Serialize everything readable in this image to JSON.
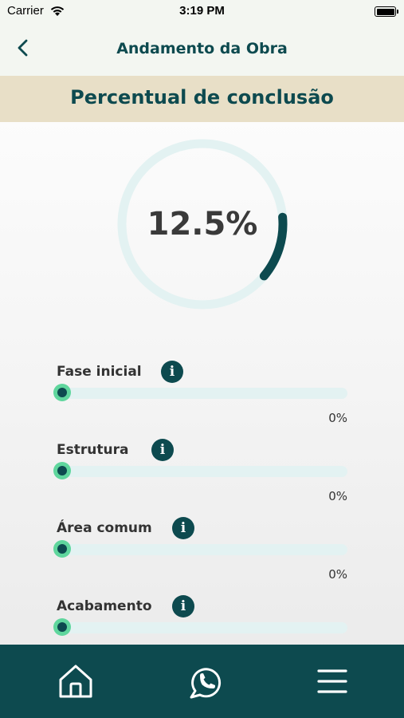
{
  "status_bar": {
    "carrier": "Carrier",
    "time": "3:19 PM",
    "icons": [
      "wifi-icon",
      "battery-icon"
    ]
  },
  "nav": {
    "title": "Andamento da Obra",
    "back_icon": "chevron-left-icon"
  },
  "section": {
    "heading": "Percentual de conclusão"
  },
  "progress": {
    "label": "12.5%",
    "fraction": 0.125
  },
  "phases": [
    {
      "label": "Fase inicial",
      "value": "0%",
      "fraction": 0
    },
    {
      "label": "Estrutura",
      "value": "0%",
      "fraction": 0
    },
    {
      "label": "Área comum",
      "value": "0%",
      "fraction": 0
    },
    {
      "label": "Acabamento",
      "value": "",
      "fraction": 0
    }
  ],
  "tab_bar": {
    "items": [
      "home-icon",
      "whatsapp-icon",
      "menu-icon"
    ]
  },
  "colors": {
    "primary": "#0d4a4f",
    "accent": "#5fd69d",
    "track": "#e3f2f2",
    "header_band": "#e8dfc7",
    "nav_bg": "#f3f6f1"
  }
}
